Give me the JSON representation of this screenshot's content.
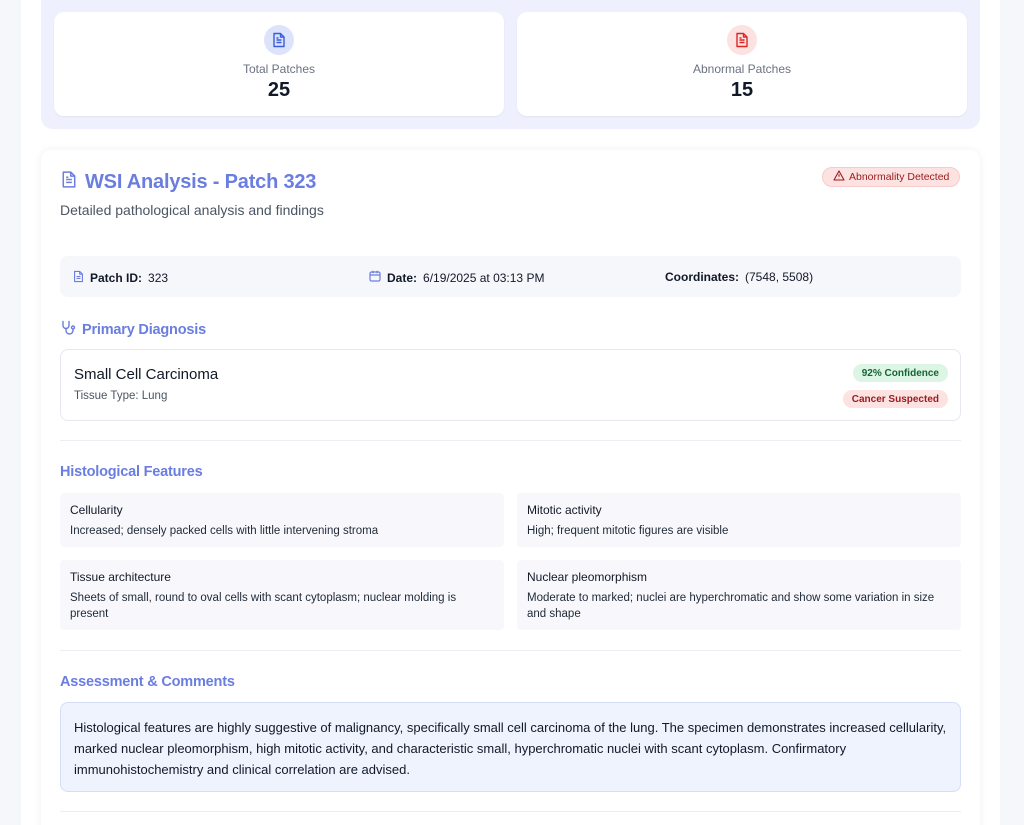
{
  "stats": {
    "total_label": "Total Patches",
    "total_value": "25",
    "abnormal_label": "Abnormal Patches",
    "abnormal_value": "15"
  },
  "report": {
    "title": "WSI Analysis - Patch 323",
    "subtitle": "Detailed pathological analysis and findings",
    "status_badge": "Abnormality Detected",
    "meta": {
      "patch_label": "Patch ID:",
      "patch_value": "323",
      "date_label": "Date:",
      "date_value": "6/19/2025 at 03:13 PM",
      "coords_label": "Coordinates:",
      "coords_value": "(7548, 5508)"
    },
    "primary_diagnosis": {
      "heading": "Primary Diagnosis",
      "name": "Small Cell Carcinoma",
      "tissue": "Tissue Type: Lung",
      "confidence": "92% Confidence",
      "flag": "Cancer Suspected"
    },
    "histological": {
      "heading": "Histological Features",
      "items": [
        {
          "name": "Cellularity",
          "value": "Increased; densely packed cells with little intervening stroma"
        },
        {
          "name": "Mitotic activity",
          "value": "High; frequent mitotic figures are visible"
        },
        {
          "name": "Tissue architecture",
          "value": "Sheets of small, round to oval cells with scant cytoplasm; nuclear molding is present"
        },
        {
          "name": "Nuclear pleomorphism",
          "value": "Moderate to marked; nuclei are hyperchromatic and show some variation in size and shape"
        }
      ]
    },
    "assessment": {
      "heading": "Assessment & Comments",
      "text": "Histological features are highly suggestive of malignancy, specifically small cell carcinoma of the lung. The specimen demonstrates increased cellularity, marked nuclear pleomorphism, high mitotic activity, and characteristic small, hyperchromatic nuclei with scant cytoplasm. Confirmatory immunohistochemistry and clinical correlation are advised."
    }
  },
  "colors": {
    "accent": "#6a7de0",
    "danger": "#dc2626",
    "success_bg": "#dcf5e4",
    "info_bg": "#eef3fd"
  },
  "icons": {
    "total": "document-icon",
    "abnormal": "document-alert-icon",
    "title": "document-icon",
    "badge": "warning-triangle-icon",
    "patch": "document-icon",
    "date": "calendar-icon",
    "diagnosis": "stethoscope-icon"
  }
}
